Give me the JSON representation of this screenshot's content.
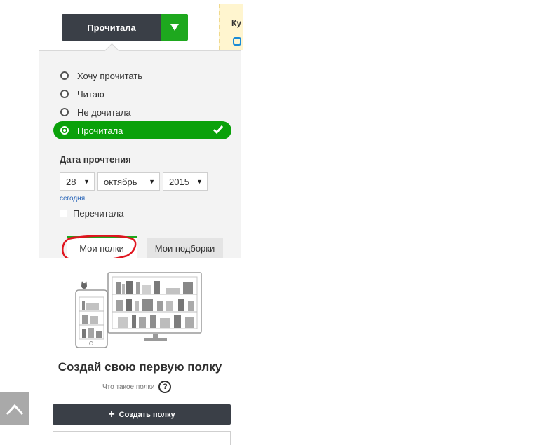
{
  "status_button": {
    "label": "Прочитала",
    "icon": "caret-down-icon"
  },
  "promo": {
    "text": "Ку"
  },
  "status_options": [
    {
      "label": "Хочу прочитать",
      "selected": false
    },
    {
      "label": "Читаю",
      "selected": false
    },
    {
      "label": "Не дочитала",
      "selected": false
    },
    {
      "label": "Прочитала",
      "selected": true
    }
  ],
  "read_date": {
    "label": "Дата прочтения",
    "day": "28",
    "month": "октябрь",
    "year": "2015",
    "today_link": "сегодня"
  },
  "reread": {
    "label": "Перечитала",
    "checked": false
  },
  "tabs": {
    "my_shelves": "Мои полки",
    "my_collections": "Мои подборки"
  },
  "empty_state": {
    "title": "Создай свою первую полку",
    "help_link": "Что такое полки",
    "help_icon": "?",
    "create_button": "Создать полку",
    "create_icon": "+"
  },
  "colors": {
    "dark": "#3a3f47",
    "green": "#1ea81e",
    "annotation_red": "#e0141e"
  }
}
